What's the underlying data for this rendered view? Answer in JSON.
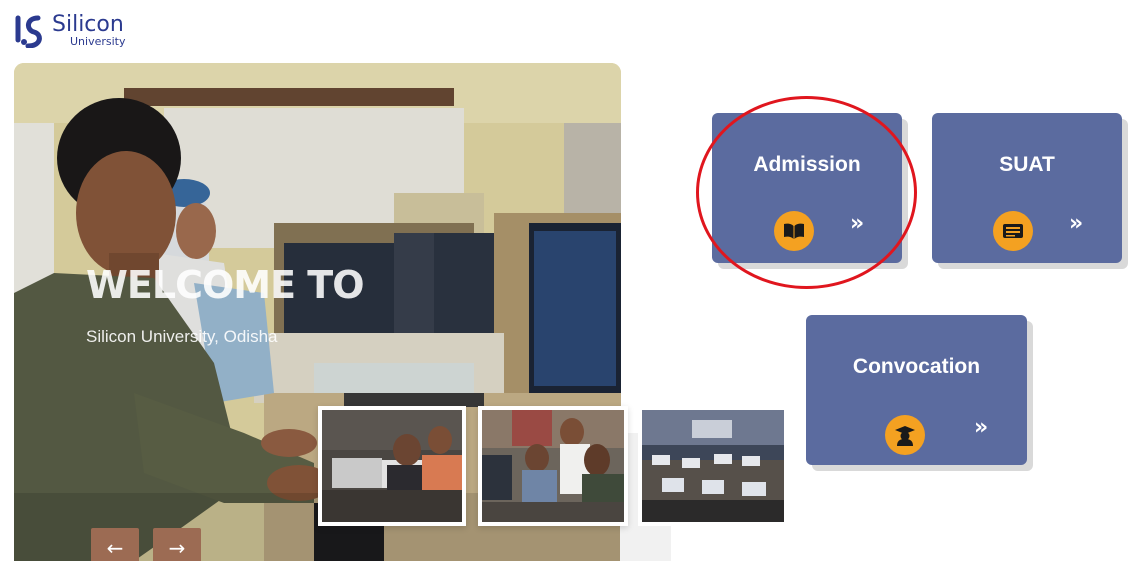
{
  "brand": {
    "name": "Silicon",
    "sub": "University"
  },
  "hero": {
    "title": "WELCOME TO",
    "subtitle": "Silicon University, Odisha",
    "prev_glyph": "←",
    "next_glyph": "→"
  },
  "cards": {
    "admission": {
      "label": "Admission",
      "icon": "book-icon",
      "arrow": "»"
    },
    "suat": {
      "label": "SUAT",
      "icon": "id-card-icon",
      "arrow": "»"
    },
    "convocation": {
      "label": "Convocation",
      "icon": "graduate-icon",
      "arrow": "»"
    }
  },
  "colors": {
    "card": "#5b6b9f",
    "icon_bg": "#f4a121",
    "nav_button": "#9c6b53",
    "highlight_ring": "#e0161e"
  }
}
